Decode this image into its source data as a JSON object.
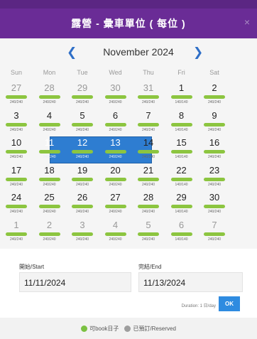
{
  "dialog": {
    "title": "露營 - 彙車單位 ( 每位 )",
    "close_glyph": "×"
  },
  "calendar": {
    "month_label": "November 2024",
    "prev_glyph": "❮",
    "next_glyph": "❯",
    "weekdays": [
      "Sun",
      "Mon",
      "Tue",
      "Wed",
      "Thu",
      "Fri",
      "Sat"
    ],
    "bar_color": "#8cc540",
    "selected_color": "#2e7dd1",
    "weeks": [
      [
        {
          "day": "27",
          "count": "240/240",
          "other": true
        },
        {
          "day": "28",
          "count": "240/240",
          "other": true
        },
        {
          "day": "29",
          "count": "240/240",
          "other": true
        },
        {
          "day": "30",
          "count": "240/240",
          "other": true
        },
        {
          "day": "31",
          "count": "240/240",
          "other": true
        },
        {
          "day": "1",
          "count": "140/140",
          "other": false
        },
        {
          "day": "2",
          "count": "240/240",
          "other": false
        }
      ],
      [
        {
          "day": "3",
          "count": "240/240",
          "other": false
        },
        {
          "day": "4",
          "count": "240/240",
          "other": false
        },
        {
          "day": "5",
          "count": "240/240",
          "other": false
        },
        {
          "day": "6",
          "count": "240/240",
          "other": false
        },
        {
          "day": "7",
          "count": "240/240",
          "other": false
        },
        {
          "day": "8",
          "count": "140/140",
          "other": false
        },
        {
          "day": "9",
          "count": "240/240",
          "other": false
        }
      ],
      [
        {
          "day": "10",
          "count": "240/240",
          "other": false
        },
        {
          "day": "11",
          "count": "240/240",
          "other": false,
          "selected": true
        },
        {
          "day": "12",
          "count": "240/240",
          "other": false,
          "selected": true
        },
        {
          "day": "13",
          "count": "240/240",
          "other": false,
          "selected": true
        },
        {
          "day": "14",
          "count": "240/240",
          "other": false
        },
        {
          "day": "15",
          "count": "140/140",
          "other": false
        },
        {
          "day": "16",
          "count": "240/240",
          "other": false
        }
      ],
      [
        {
          "day": "17",
          "count": "240/240",
          "other": false
        },
        {
          "day": "18",
          "count": "240/240",
          "other": false
        },
        {
          "day": "19",
          "count": "240/240",
          "other": false
        },
        {
          "day": "20",
          "count": "240/240",
          "other": false
        },
        {
          "day": "21",
          "count": "240/240",
          "other": false
        },
        {
          "day": "22",
          "count": "140/140",
          "other": false
        },
        {
          "day": "23",
          "count": "240/240",
          "other": false
        }
      ],
      [
        {
          "day": "24",
          "count": "240/240",
          "other": false
        },
        {
          "day": "25",
          "count": "240/240",
          "other": false
        },
        {
          "day": "26",
          "count": "240/240",
          "other": false
        },
        {
          "day": "27",
          "count": "240/240",
          "other": false
        },
        {
          "day": "28",
          "count": "240/240",
          "other": false
        },
        {
          "day": "29",
          "count": "140/140",
          "other": false
        },
        {
          "day": "30",
          "count": "240/240",
          "other": false
        }
      ],
      [
        {
          "day": "1",
          "count": "240/240",
          "other": true
        },
        {
          "day": "2",
          "count": "240/240",
          "other": true
        },
        {
          "day": "3",
          "count": "240/240",
          "other": true
        },
        {
          "day": "4",
          "count": "240/240",
          "other": true
        },
        {
          "day": "5",
          "count": "240/240",
          "other": true
        },
        {
          "day": "6",
          "count": "140/140",
          "other": true
        },
        {
          "day": "7",
          "count": "240/240",
          "other": true
        }
      ]
    ]
  },
  "form": {
    "start_label": "開始/Start",
    "start_value": "11/11/2024",
    "end_label": "完結/End",
    "end_value": "11/13/2024",
    "duration_text": "Duration: 1 日/day",
    "ok_label": "OK",
    "ok_color": "#2e8be0"
  },
  "legend": {
    "available_label": "可book日子",
    "available_color": "#7bc142",
    "reserved_label": "已預訂/Reserved",
    "reserved_color": "#9e9e9e"
  }
}
